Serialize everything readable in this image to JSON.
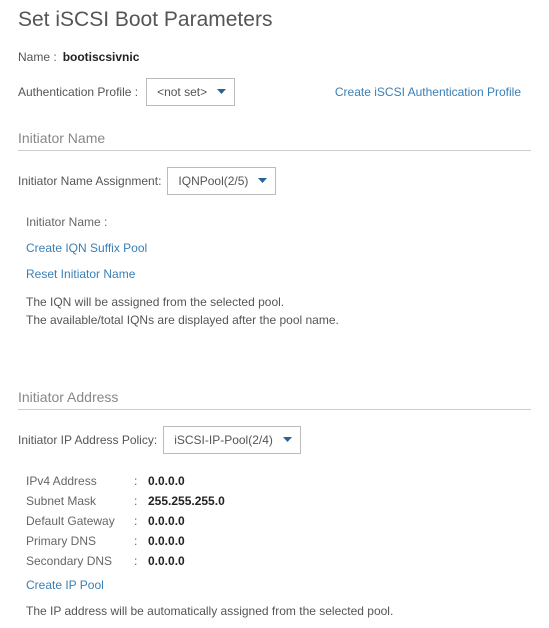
{
  "title": "Set iSCSI Boot Parameters",
  "name": {
    "label": "Name :",
    "value": "bootiscsivnic"
  },
  "auth_profile": {
    "label": "Authentication Profile :",
    "selected": "<not set>",
    "create_link": "Create iSCSI Authentication Profile"
  },
  "initiator_name": {
    "section_title": "Initiator Name",
    "assignment_label": "Initiator Name Assignment:",
    "assignment_value": "IQNPool(2/5)",
    "name_label": "Initiator Name :",
    "create_link": "Create IQN Suffix Pool",
    "reset_link": "Reset Initiator Name",
    "note_line1": "The IQN will be assigned from the selected pool.",
    "note_line2": "The available/total IQNs are displayed after the pool name."
  },
  "initiator_address": {
    "section_title": "Initiator Address",
    "policy_label": "Initiator IP Address Policy:",
    "policy_value": "iSCSI-IP-Pool(2/4)",
    "fields": [
      {
        "key": "IPv4 Address",
        "value": "0.0.0.0"
      },
      {
        "key": "Subnet Mask",
        "value": "255.255.255.0"
      },
      {
        "key": "Default Gateway",
        "value": "0.0.0.0"
      },
      {
        "key": "Primary DNS",
        "value": "0.0.0.0"
      },
      {
        "key": "Secondary DNS",
        "value": "0.0.0.0"
      }
    ],
    "create_link": "Create IP Pool",
    "note": "The IP address will be automatically assigned from the selected pool."
  }
}
